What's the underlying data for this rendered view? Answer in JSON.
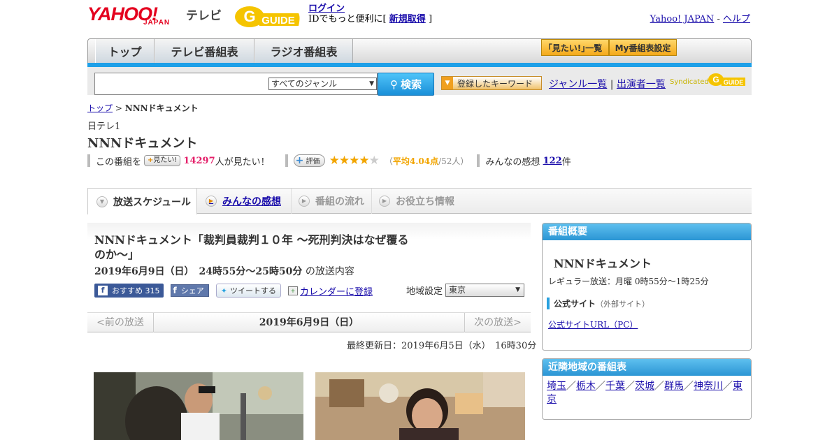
{
  "header": {
    "logo_yahoo": "YAHOO!",
    "logo_japan": "JAPAN",
    "logo_tv": "テレビ",
    "logo_gguide": "GUIDE",
    "login_link": "ログイン",
    "login_text": "IDでもっと便利に[",
    "signup_link": "新規取得",
    "signup_close": "]",
    "yahoo_japan_link": "Yahoo! JAPAN",
    "dash": "-",
    "help_link": "ヘルプ"
  },
  "nav": {
    "tabs": [
      {
        "label": "トップ"
      },
      {
        "label": "テレビ番組表"
      },
      {
        "label": "ラジオ番組表"
      }
    ],
    "mitai_list": "｢見たい!｣一覧",
    "my_schedule": "My番組表設定"
  },
  "search": {
    "placeholder": "",
    "genre_selected": "すべてのジャンル",
    "button_label": "検索",
    "keyword_button": "登録したキーワード",
    "genre_list": "ジャンル一覧",
    "divider": "|",
    "performer_list": "出演者一覧",
    "syndicated": "Syndicated"
  },
  "breadcrumb": {
    "top": "トップ",
    "separator": ">",
    "current": "NNNドキュメント"
  },
  "program": {
    "channel": "日テレ1",
    "title": "NNNドキュメント",
    "mitai_prefix": "この番組を",
    "mitai_button": "見たい!",
    "mitai_count": "14297",
    "mitai_suffix": "人が見たい！",
    "eval_button": "評価",
    "rating_stars": 4,
    "avg_open": "（",
    "avg_label": "平均4.04点",
    "avg_rest": "/52人）",
    "impressions_label": "みんなの感想",
    "impressions_count": "122",
    "impressions_unit": "件"
  },
  "subtabs": [
    {
      "label": "放送スケジュール"
    },
    {
      "label": "みんなの感想"
    },
    {
      "label": "番組の流れ"
    },
    {
      "label": "お役立ち情報"
    }
  ],
  "episode": {
    "title": "NNNドキュメント「裁判員裁判１０年 ～死刑判決はなぜ覆るのか～」",
    "date": "2019年6月9日（日）　24時55分～25時50分",
    "date_suffix": "の放送内容",
    "fb_recommend": "おすすめ",
    "fb_count": "315",
    "share": "シェア",
    "tweet": "ツイートする",
    "calendar": "カレンダーに登録",
    "region_label": "地域設定",
    "region_value": "東京"
  },
  "pager": {
    "prev": "<前の放送",
    "date": "2019年6月9日（日）",
    "next": "次の放送>"
  },
  "updated": "最終更新日：2019年6月5日（水）　16時30分",
  "sidebar": {
    "overview_head": "番組概要",
    "overview_name": "NNNドキュメント",
    "regular": "レギュラー放送：月曜 0時55分～1時25分",
    "official_head": "公式サイト",
    "official_note": "（外部サイト）",
    "official_link": "公式サイトURL（PC）",
    "nearby_head": "近隣地域の番組表",
    "nearby": [
      "埼玉",
      "栃木",
      "千葉",
      "茨城",
      "群馬",
      "神奈川",
      "東京"
    ]
  },
  "colors": {
    "accent_blue": "#1ea0e8",
    "yahoo_red": "#e4001e",
    "star": "#f2a500",
    "count_pink": "#e4206a"
  }
}
